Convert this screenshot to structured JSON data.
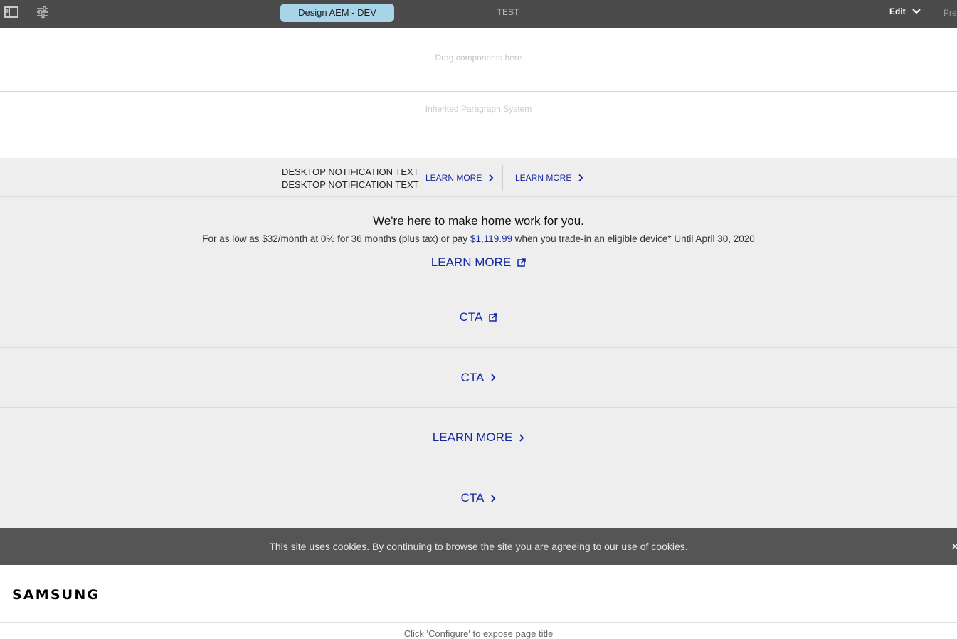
{
  "toolbar": {
    "environment": "Design AEM - DEV",
    "page_name": "TEST",
    "mode": "Edit",
    "preview": "Preview"
  },
  "placeholders": {
    "dropzone": "Drag components here",
    "iparsys": "Inherited Paragraph System"
  },
  "notification": {
    "line1": "DESKTOP NOTIFICATION TEXT",
    "line2": "DESKTOP NOTIFICATION TEXT",
    "link1": "LEARN MORE",
    "link2": "LEARN MORE"
  },
  "promo": {
    "title": "We're here to make home work for you.",
    "sub_before": "For as low as $32/month at 0% for 36 months (plus tax) or pay",
    "price": "$1,119.99",
    "sub_after": "when you trade-in an eligible device* Until April 30, 2020",
    "link": "LEARN MORE"
  },
  "ctas": [
    {
      "label": "CTA",
      "icon": "external-link-icon"
    },
    {
      "label": "CTA",
      "icon": "chevron-right-icon"
    },
    {
      "label": "LEARN MORE",
      "icon": "chevron-right-icon"
    },
    {
      "label": "CTA",
      "icon": "chevron-right-icon"
    }
  ],
  "cookie": {
    "text": "This site uses cookies. By continuing to browse the site you are agreeing to our use of cookies.",
    "close": "×"
  },
  "header": {
    "logo": "SAMSUNG",
    "page_title_hint": "Click 'Configure' to expose page title"
  },
  "colors": {
    "toolbar_bg": "#4b4b4b",
    "env_pill": "#a7d4e6",
    "link_blue": "#1428a0",
    "section_bg": "#eeeeee",
    "cookie_bg": "#555555"
  }
}
